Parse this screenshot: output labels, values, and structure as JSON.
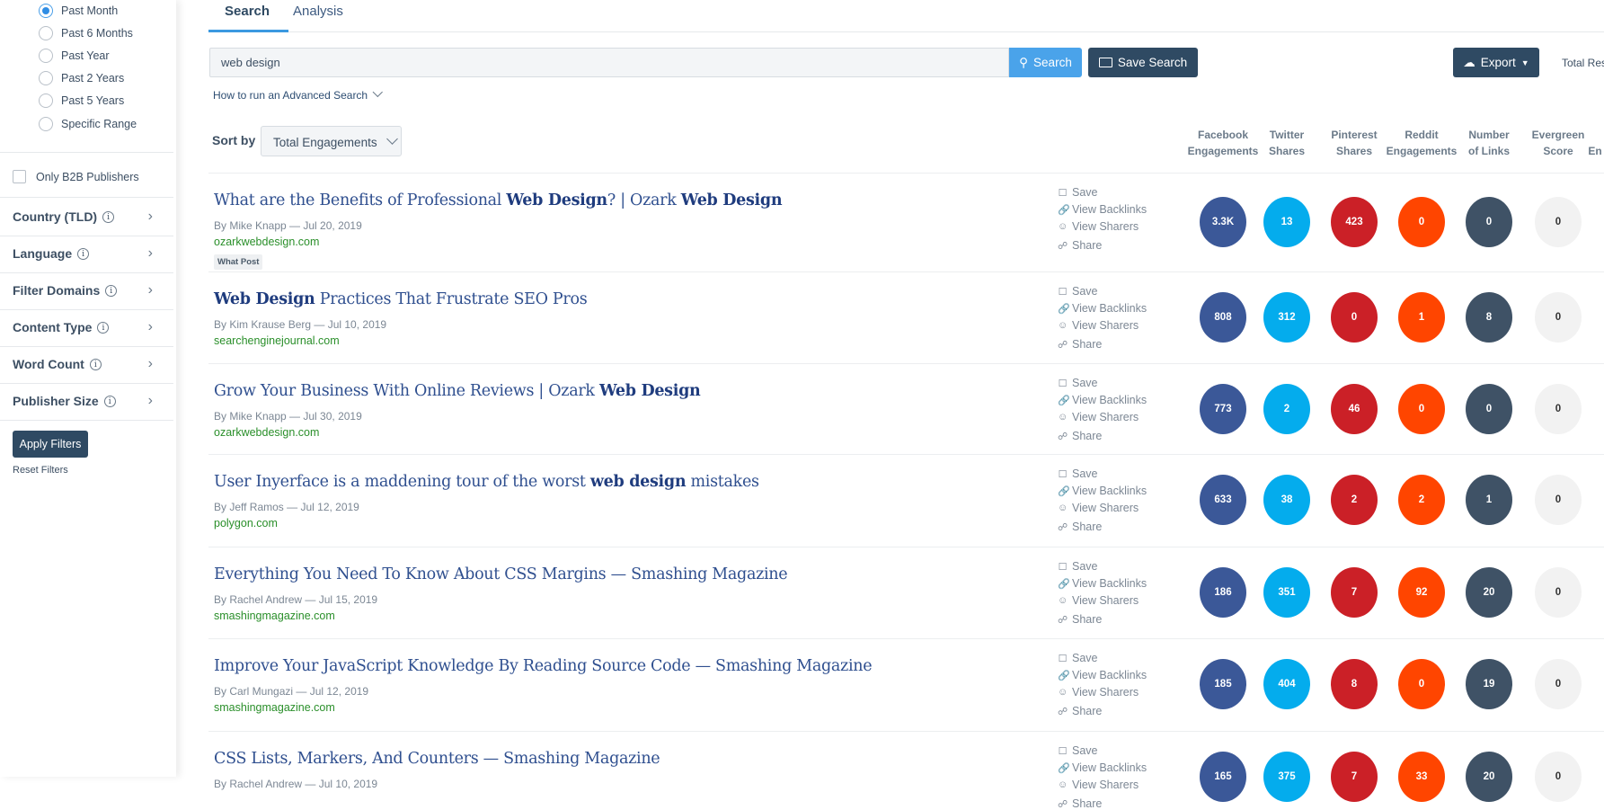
{
  "sidebar": {
    "date_options": [
      {
        "label": "Past Month",
        "selected": true
      },
      {
        "label": "Past 6 Months"
      },
      {
        "label": "Past Year"
      },
      {
        "label": "Past 2 Years"
      },
      {
        "label": "Past 5 Years"
      },
      {
        "label": "Specific Range"
      }
    ],
    "b2b_label": "Only B2B Publishers",
    "filters": [
      "Country (TLD)",
      "Language",
      "Filter Domains",
      "Content Type",
      "Word Count",
      "Publisher Size"
    ],
    "apply_label": "Apply Filters",
    "reset_label": "Reset Filters"
  },
  "tabs": [
    "Search",
    "Analysis"
  ],
  "search": {
    "value": "web design",
    "button": "Search",
    "save": "Save Search",
    "export": "Export",
    "total": "Total Res",
    "advanced": "How to run an Advanced Search"
  },
  "sort": {
    "label": "Sort by",
    "value": "Total Engagements"
  },
  "columns": [
    "Facebook\nEngagements",
    "Twitter\nShares",
    "Pinterest\nShares",
    "Reddit\nEngagements",
    "Number\nof Links",
    "Evergreen\nScore",
    "En"
  ],
  "actions": [
    "Save",
    "View Backlinks",
    "View Sharers",
    "Share"
  ],
  "colors": {
    "facebook": "#3b5898",
    "twitter": "#04aced",
    "pinterest": "#cb2027",
    "reddit": "#ff4500",
    "links": "#3f5266",
    "evergreen": "#f2f2f2"
  },
  "rows": [
    {
      "title": [
        {
          "t": "What are the Benefits of Professional "
        },
        {
          "t": "Web Design",
          "b": true
        },
        {
          "t": "? | Ozark "
        },
        {
          "t": "Web Design",
          "b": true
        }
      ],
      "meta": "By Mike Knapp — Jul 20, 2019",
      "domain": "ozarkwebdesign.com",
      "badge": "What Post",
      "values": [
        "3.3K",
        "13",
        "423",
        "0",
        "0",
        "0"
      ]
    },
    {
      "title": [
        {
          "t": "Web Design",
          "b": true
        },
        {
          "t": " Practices That Frustrate SEO Pros"
        }
      ],
      "meta": "By Kim Krause Berg — Jul 10, 2019",
      "domain": "searchenginejournal.com",
      "values": [
        "808",
        "312",
        "0",
        "1",
        "8",
        "0"
      ]
    },
    {
      "title": [
        {
          "t": "Grow Your Business With Online Reviews | Ozark "
        },
        {
          "t": "Web Design",
          "b": true
        }
      ],
      "meta": "By Mike Knapp — Jul 30, 2019",
      "domain": "ozarkwebdesign.com",
      "values": [
        "773",
        "2",
        "46",
        "0",
        "0",
        "0"
      ]
    },
    {
      "title": [
        {
          "t": "User Inyerface is a maddening tour of the worst "
        },
        {
          "t": "web design",
          "b": true
        },
        {
          "t": " mistakes"
        }
      ],
      "meta": "By Jeff Ramos — Jul 12, 2019",
      "domain": "polygon.com",
      "values": [
        "633",
        "38",
        "2",
        "2",
        "1",
        "0"
      ]
    },
    {
      "title": [
        {
          "t": "Everything You Need To Know About CSS Margins — Smashing Magazine"
        }
      ],
      "meta": "By Rachel Andrew — Jul 15, 2019",
      "domain": "smashingmagazine.com",
      "values": [
        "186",
        "351",
        "7",
        "92",
        "20",
        "0"
      ]
    },
    {
      "title": [
        {
          "t": "Improve Your JavaScript Knowledge By Reading Source Code — Smashing Magazine"
        }
      ],
      "meta": "By Carl Mungazi — Jul 12, 2019",
      "domain": "smashingmagazine.com",
      "values": [
        "185",
        "404",
        "8",
        "0",
        "19",
        "0"
      ]
    },
    {
      "title": [
        {
          "t": "CSS Lists, Markers, And Counters — Smashing Magazine"
        }
      ],
      "meta": "By Rachel Andrew — Jul 10, 2019",
      "domain": "",
      "values": [
        "165",
        "375",
        "7",
        "33",
        "20",
        "0"
      ]
    }
  ]
}
